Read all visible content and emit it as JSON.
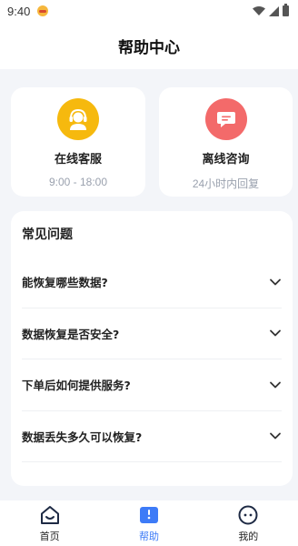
{
  "status_bar": {
    "time": "9:40"
  },
  "header": {
    "title": "帮助中心"
  },
  "services": [
    {
      "title": "在线客服",
      "subtitle": "9:00 - 18:00",
      "icon": "headset-agent-icon",
      "color": "#F6B90E"
    },
    {
      "title": "离线咨询",
      "subtitle": "24小时内回复",
      "icon": "chat-bubble-icon",
      "color": "#F36A6A"
    }
  ],
  "faq": {
    "heading": "常见问题",
    "items": [
      {
        "question": "能恢复哪些数据?"
      },
      {
        "question": "数据恢复是否安全?"
      },
      {
        "question": "下单后如何提供服务?"
      },
      {
        "question": "数据丢失多久可以恢复?"
      }
    ]
  },
  "tabs": [
    {
      "label": "首页",
      "icon": "home-icon",
      "active": false
    },
    {
      "label": "帮助",
      "icon": "help-book-icon",
      "active": true
    },
    {
      "label": "我的",
      "icon": "profile-face-icon",
      "active": false
    }
  ],
  "colors": {
    "accent": "#3D7BF7",
    "background": "#F3F5F9"
  }
}
